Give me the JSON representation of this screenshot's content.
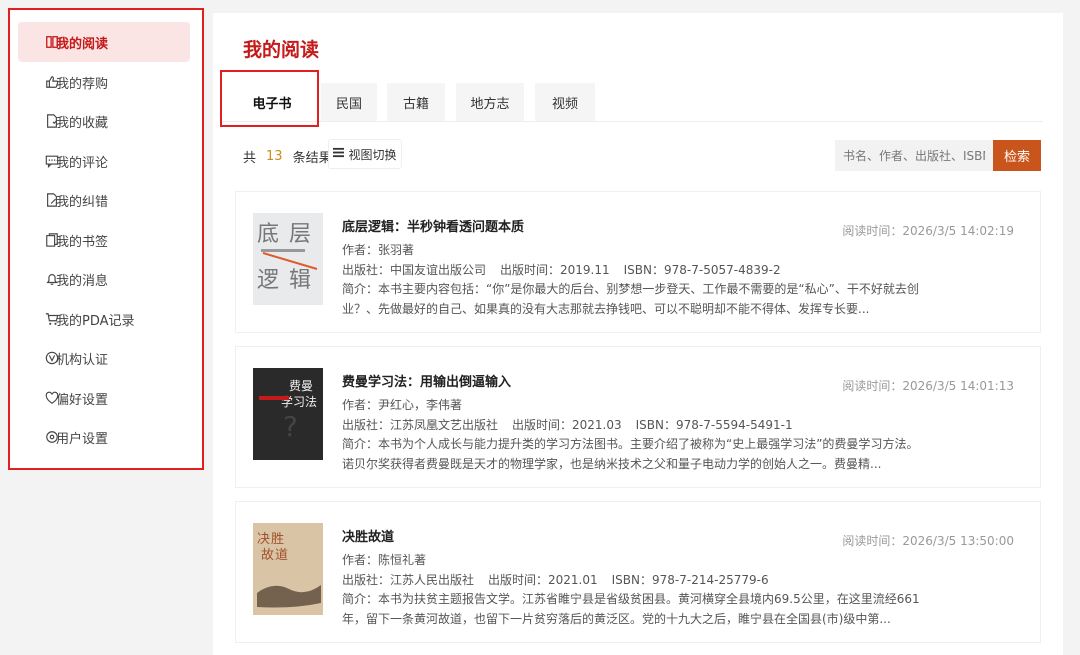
{
  "sidebar": {
    "items": [
      {
        "label": "我的阅读",
        "icon": "book-open-icon",
        "active": true
      },
      {
        "label": "我的荐购",
        "icon": "thumb-up-icon"
      },
      {
        "label": "我的收藏",
        "icon": "bookmark-doc-icon"
      },
      {
        "label": "我的评论",
        "icon": "comment-icon"
      },
      {
        "label": "我的纠错",
        "icon": "edit-doc-icon"
      },
      {
        "label": "我的书签",
        "icon": "copy-icon"
      },
      {
        "label": "我的消息",
        "icon": "bell-icon"
      },
      {
        "label": "我的PDA记录",
        "icon": "cart-icon"
      },
      {
        "label": "机构认证",
        "icon": "badge-icon"
      },
      {
        "label": "偏好设置",
        "icon": "heart-icon"
      },
      {
        "label": "用户设置",
        "icon": "settings-icon"
      }
    ]
  },
  "main": {
    "title": "我的阅读",
    "tabs": [
      {
        "label": "电子书",
        "active": true
      },
      {
        "label": "民国"
      },
      {
        "label": "古籍"
      },
      {
        "label": "地方志"
      },
      {
        "label": "视频"
      }
    ],
    "results": {
      "prefix": "共",
      "count": "13",
      "suffix": "条结果"
    },
    "view_toggle": "视图切换",
    "search": {
      "placeholder": "书名、作者、出版社、ISBN",
      "button": "检索"
    },
    "books": [
      {
        "title": "底层逻辑：半秒钟看透问题本质",
        "author": "作者：张羽著",
        "publisher": "出版社：中国友谊出版公司",
        "pubdate": "出版时间：2019.11",
        "isbn": "ISBN：978-7-5057-4839-2",
        "desc": "简介：本书主要内容包括：“你”是你最大的后台、别梦想一步登天、工作最不需要的是“私心”、干不好就去创业？、先做最好的自己、如果真的没有大志那就去挣钱吧、可以不聪明却不能不得体、发挥专长要...",
        "time": "阅读时间：2026/3/5 14:02:19",
        "cover_chars": [
          "底",
          "层",
          "逻",
          "辑"
        ]
      },
      {
        "title": "费曼学习法：用输出倒逼输入",
        "author": "作者：尹红心，李伟著",
        "publisher": "出版社：江苏凤凰文艺出版社",
        "pubdate": "出版时间：2021.03",
        "isbn": "ISBN：978-7-5594-5491-1",
        "desc": "简介：本书为个人成长与能力提升类的学习方法图书。主要介绍了被称为“史上最强学习法”的费曼学习方法。诺贝尔奖获得者费曼既是天才的物理学家，也是纳米技术之父和量子电动力学的创始人之一。费曼精...",
        "time": "阅读时间：2026/3/5 14:01:13",
        "cover_chars": [
          "费曼",
          "学习法"
        ]
      },
      {
        "title": "决胜故道",
        "author": "作者：陈恒礼著",
        "publisher": "出版社：江苏人民出版社",
        "pubdate": "出版时间：2021.01",
        "isbn": "ISBN：978-7-214-25779-6",
        "desc": "简介：本书为扶贫主题报告文学。江苏省睢宁县是省级贫困县。黄河横穿全县境内69.5公里，在这里流经661年，留下一条黄河故道，也留下一片贫穷落后的黄泛区。党的十九大之后，睢宁县在全国县(市)级中第...",
        "time": "阅读时间：2026/3/5 13:50:00",
        "cover_chars": [
          "决",
          "胜",
          "故",
          "道"
        ]
      }
    ]
  },
  "colors": {
    "accent": "#c41a1a",
    "highlight_border": "#e02020",
    "search_button": "#c9541c",
    "count": "#d08a20"
  }
}
